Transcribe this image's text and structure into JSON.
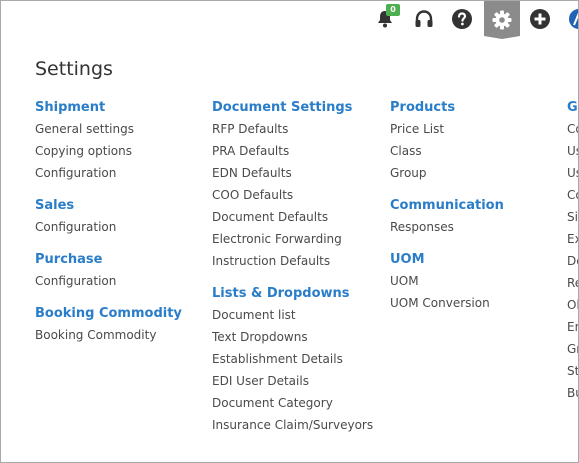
{
  "topbar": {
    "notification_count": "0"
  },
  "panel": {
    "title": "Settings"
  },
  "columns": [
    {
      "sections": [
        {
          "title": "Shipment",
          "links": [
            "General settings",
            "Copying options",
            "Configuration"
          ]
        },
        {
          "title": "Sales",
          "links": [
            "Configuration"
          ]
        },
        {
          "title": "Purchase",
          "links": [
            "Configuration"
          ]
        },
        {
          "title": "Booking Commodity",
          "links": [
            "Booking Commodity"
          ]
        }
      ]
    },
    {
      "sections": [
        {
          "title": "Document Settings",
          "links": [
            "RFP Defaults",
            "PRA Defaults",
            "EDN Defaults",
            "COO Defaults",
            "Document Defaults",
            "Electronic Forwarding",
            "Instruction Defaults"
          ]
        },
        {
          "title": "Lists & Dropdowns",
          "links": [
            "Document list",
            "Text Dropdowns",
            "Establishment Details",
            "EDI User Details",
            "Document Category",
            "Insurance Claim/Surveyors"
          ]
        }
      ]
    },
    {
      "sections": [
        {
          "title": "Products",
          "links": [
            "Price List",
            "Class",
            "Group"
          ]
        },
        {
          "title": "Communication",
          "links": [
            "Responses"
          ]
        },
        {
          "title": "UOM",
          "links": [
            "UOM",
            "UOM Conversion"
          ]
        }
      ]
    },
    {
      "sections": [
        {
          "title": "Ge",
          "links": [
            "Co",
            "Us",
            "Us",
            "Co",
            "Sig",
            "Ex",
            "De",
            "Re",
            "Ob",
            "Em",
            "Gr",
            "Sta",
            "Bu"
          ]
        }
      ]
    }
  ]
}
